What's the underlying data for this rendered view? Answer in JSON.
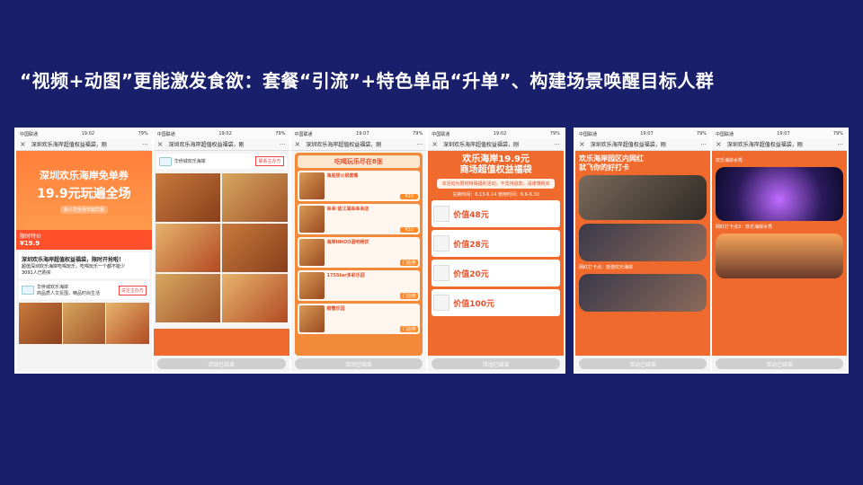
{
  "slide": {
    "title": "“视频+动图”更能激发食欲：套餐“引流”+特色单品“升单”、构建场景唤醒目标人群"
  },
  "phones": {
    "common": {
      "carrier": "中国联通",
      "battery": "79%",
      "wx_title": "深圳欢乐海岸超值权益福袋，刚",
      "close": "×",
      "more": "···",
      "ended": "活动已结束"
    },
    "p1": {
      "time": "19:02",
      "banner_l1": "深圳欢乐海岸免单券",
      "banner_l2": "19.9元玩遍全场",
      "banner_l3": "新人享全场专属优惠",
      "sale_label": "限时特价",
      "sale_price": "¥19.9",
      "card_title": "深圳欢乐海岸超值权益福袋，限时开抢啦！",
      "card_desc": "超值深圳欢乐海岸吃喝玩乐，吃喝玩乐一个都不能少",
      "sold": "3091人已购买",
      "shop_name": "华侨城欢乐海岸",
      "shop_desc": "商品质人文氛围，精品时尚生活",
      "follow": "关注主办方"
    },
    "p2": {
      "time": "19:02",
      "shop_name": "华侨城欢乐海岸",
      "follow": "联系主办方"
    },
    "p3": {
      "time": "19:07",
      "header": "吃喝玩乐尽在8张",
      "items": [
        {
          "name": "海底捞火锅套餐",
          "tag": "¥10"
        },
        {
          "name": "串串·蓝江湖串串串店",
          "tag": "¥10"
        },
        {
          "name": "海岸HHOO酒吧畅饮",
          "tag": "门店券"
        },
        {
          "name": "175Star多彩乐园",
          "tag": "门店券"
        },
        {
          "name": "螃蟹乐园",
          "tag": "门店券"
        }
      ]
    },
    "p4": {
      "time": "19:02",
      "title_l1": "欢乐海岸19.9元",
      "title_l2": "商场超值权益福袋",
      "note": "本活动为限时特殊福利活动，不支持退款，请谨慎购买",
      "dates": "兑换时间：6.13-6.14   使用时间：6.6-6.30",
      "rows": [
        {
          "value": "价值48元"
        },
        {
          "value": "价值28元"
        },
        {
          "value": "价值20元"
        },
        {
          "value": "价值100元"
        }
      ]
    },
    "p5": {
      "time": "19:07",
      "title_l1": "欢乐海岸园区内网红",
      "title_l2": "就飞你的好打卡",
      "caption": "网红打卡点：夜游欢乐海岸"
    },
    "p6": {
      "time": "19:07",
      "title": "欢乐海岸水秀",
      "caption": "网红打卡点3：欢乐海岸水秀"
    }
  }
}
